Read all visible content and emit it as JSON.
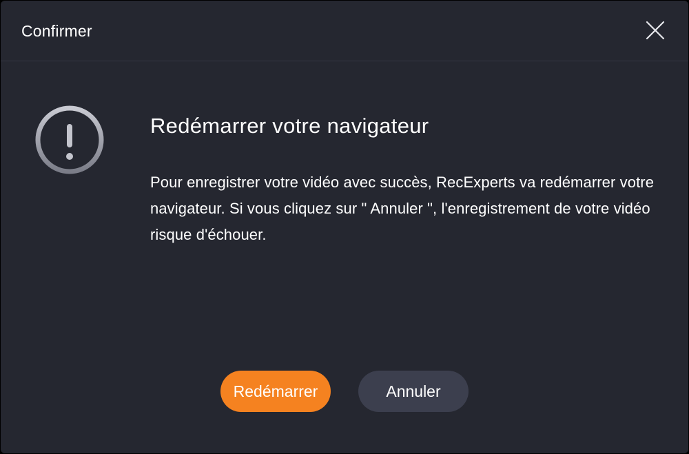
{
  "dialog": {
    "title": "Confirmer",
    "close_icon": "close-icon",
    "warning_icon": "exclamation-circle-icon",
    "heading": "Redémarrer votre navigateur",
    "message": "Pour enregistrer votre vidéo avec succès, RecExperts va redémarrer votre navigateur. Si vous cliquez sur \" Annuler \", l'enregistrement de votre vidéo risque d'échouer.",
    "primary_button": "Redémarrer",
    "secondary_button": "Annuler"
  },
  "colors": {
    "background": "#252730",
    "primary_accent": "#f58220",
    "secondary_button": "#3c3f4e",
    "text": "#ffffff"
  }
}
